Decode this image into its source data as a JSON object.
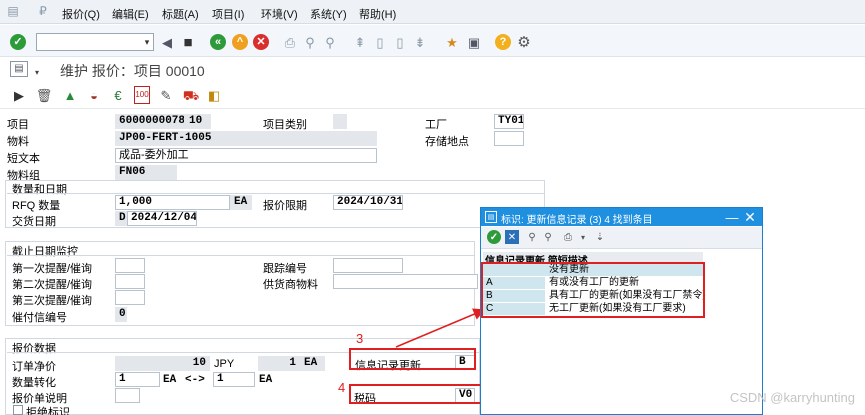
{
  "menubar": {
    "items": [
      "报价(Q)",
      "编辑(E)",
      "标题(A)",
      "项目(I)",
      "环境(V)",
      "系统(Y)",
      "帮助(H)"
    ]
  },
  "toolbar": {
    "command_value": ""
  },
  "page_title": "维护 报价：项目 00010",
  "form": {
    "item_label": "项目",
    "item_value": "6000000078",
    "item_no": "10",
    "item_cat_label": "项目类别",
    "plant_label": "工厂",
    "plant_value": "TY01",
    "material_label": "物料",
    "material_value": "JP00-FERT-1005",
    "storage_label": "存储地点",
    "short_text_label": "短文本",
    "short_text_value": "成品-委外加工",
    "matgroup_label": "物料组",
    "matgroup_value": "FN06"
  },
  "qty_section": {
    "title": "数量和日期",
    "rfq_label": "RFQ 数量",
    "rfq_value": "1,000",
    "rfq_unit": "EA",
    "deadline_label": "报价限期",
    "deadline_value": "2024/10/31",
    "delivery_label": "交货日期",
    "delivery_type": "D",
    "delivery_value": "2024/12/04"
  },
  "deadline_section": {
    "title": "截止日期监控",
    "reminder1": "第一次提醒/催询",
    "reminder2": "第二次提醒/催询",
    "reminder3": "第三次提醒/催询",
    "dunning_label": "催付信编号",
    "dunning_value": "0",
    "tracking_label": "跟踪编号",
    "vendor_mat_label": "供货商物料"
  },
  "quote_section": {
    "title": "报价数据",
    "net_price_label": "订单净价",
    "net_price_value": "10",
    "currency": "JPY",
    "per_value": "1",
    "per_unit": "EA",
    "info_update_label": "信息记录更新",
    "info_update_value": "B",
    "conv_label": "数量转化",
    "conv_left": "1",
    "conv_left_unit": "EA",
    "conv_arrow": "<->",
    "conv_right": "1",
    "conv_right_unit": "EA",
    "tax_label": "税码",
    "tax_value": "V0",
    "quote_desc_label": "报价单说明",
    "reject_label": "拒绝标识"
  },
  "annotations": {
    "n3": "3",
    "n4": "4"
  },
  "popup": {
    "title": "标识: 更新信息记录 (3)    4 找到条目",
    "header": "信息记录更新 简短描述",
    "rows": [
      {
        "code": "",
        "desc": "没有更新"
      },
      {
        "code": "A",
        "desc": "有或没有工厂的更新"
      },
      {
        "code": "B",
        "desc": "具有工厂的更新(如果没有工厂禁令)"
      },
      {
        "code": "C",
        "desc": "无工厂更新(如果没有工厂要求)"
      }
    ]
  },
  "watermark": "CSDN @karryhunting",
  "colors": {
    "menubar_bg": "#eef2f7",
    "popup_title_bg": "#1f8fe0",
    "highlight_row": "#cfe6ef",
    "annotation_red": "#e02020"
  }
}
